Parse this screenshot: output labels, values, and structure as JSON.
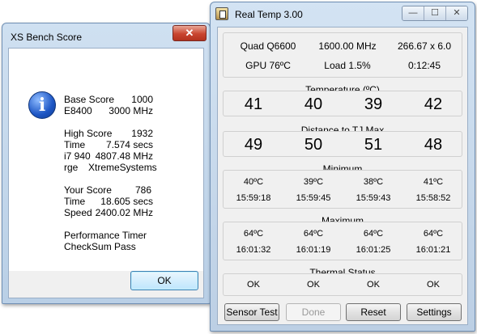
{
  "xs_bench": {
    "title": "XS Bench Score",
    "close_label": "✕",
    "rows": [
      {
        "k": "Base Score",
        "v": "1000"
      },
      {
        "k": "E8400",
        "v": "3000 MHz"
      },
      {
        "k": "High Score",
        "v": "1932"
      },
      {
        "k": "Time",
        "v": "7.574 secs"
      },
      {
        "k": "i7 940",
        "v": "4807.48 MHz"
      },
      {
        "k": "rge",
        "v": "XtremeSystems"
      },
      {
        "k": "Your Score",
        "v": "786"
      },
      {
        "k": "Time",
        "v": "18.605 secs"
      },
      {
        "k": "Speed",
        "v": "2400.02 MHz"
      },
      {
        "k": "Performance Timer",
        "v": ""
      },
      {
        "k": "CheckSum Pass",
        "v": ""
      }
    ],
    "ok_label": "OK"
  },
  "real_temp": {
    "title": "Real Temp 3.00",
    "caption": {
      "minimize": "—",
      "maximize": "☐",
      "close": "✕"
    },
    "info": {
      "cpu": "Quad Q6600",
      "freq": "1600.00 MHz",
      "mult": "266.67 x 6.0",
      "gpu": "GPU  76ºC",
      "load": "Load   1.5%",
      "uptime": "0:12:45"
    },
    "temperature": {
      "label": "Temperature (ºC)",
      "values": [
        "41",
        "40",
        "39",
        "42"
      ]
    },
    "distance": {
      "label": "Distance to TJ Max",
      "values": [
        "49",
        "50",
        "51",
        "48"
      ]
    },
    "minimum": {
      "label": "Minimum",
      "temps": [
        "40ºC",
        "39ºC",
        "38ºC",
        "41ºC"
      ],
      "times": [
        "15:59:18",
        "15:59:45",
        "15:59:43",
        "15:58:52"
      ]
    },
    "maximum": {
      "label": "Maximum",
      "temps": [
        "64ºC",
        "64ºC",
        "64ºC",
        "64ºC"
      ],
      "times": [
        "16:01:32",
        "16:01:19",
        "16:01:25",
        "16:01:21"
      ]
    },
    "thermal": {
      "label": "Thermal Status",
      "values": [
        "OK",
        "OK",
        "OK",
        "OK"
      ]
    },
    "buttons": {
      "sensor_test": "Sensor Test",
      "done": "Done",
      "reset": "Reset",
      "settings": "Settings"
    }
  }
}
